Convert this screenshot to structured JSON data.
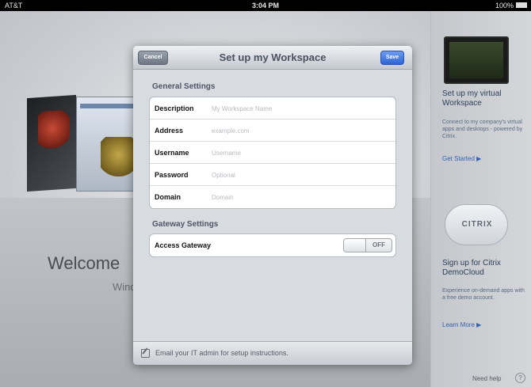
{
  "status_bar": {
    "carrier": "AT&T",
    "time": "3:04 PM",
    "battery": "100%"
  },
  "background": {
    "welcome": "Welcome",
    "subtitle": "Wind"
  },
  "right_panel": {
    "workspace_title": "Set up my virtual Workspace",
    "workspace_text": "Connect to my company's virtual apps and desktops - powered by Citrix.",
    "get_started": "Get Started ▶",
    "citrix_logo": "CITRIX",
    "democloud_title": "Sign up for Citrix DemoCloud",
    "democloud_text": "Experience on-demand apps with a free demo account.",
    "learn_more": "Learn More ▶",
    "need_help": "Need help",
    "help_icon": "?"
  },
  "modal": {
    "title": "Set up my Workspace",
    "cancel": "Cancel",
    "save": "Save",
    "general_settings": "General Settings",
    "fields": [
      {
        "label": "Description",
        "placeholder": "My Workspace Name"
      },
      {
        "label": "Address",
        "placeholder": "example.com"
      },
      {
        "label": "Username",
        "placeholder": "Username"
      },
      {
        "label": "Password",
        "placeholder": "Optional"
      },
      {
        "label": "Domain",
        "placeholder": "Domain"
      }
    ],
    "gateway_settings": "Gateway Settings",
    "access_gateway": {
      "label": "Access Gateway",
      "state": "OFF"
    },
    "footer_text": "Email your IT admin for setup instructions."
  }
}
